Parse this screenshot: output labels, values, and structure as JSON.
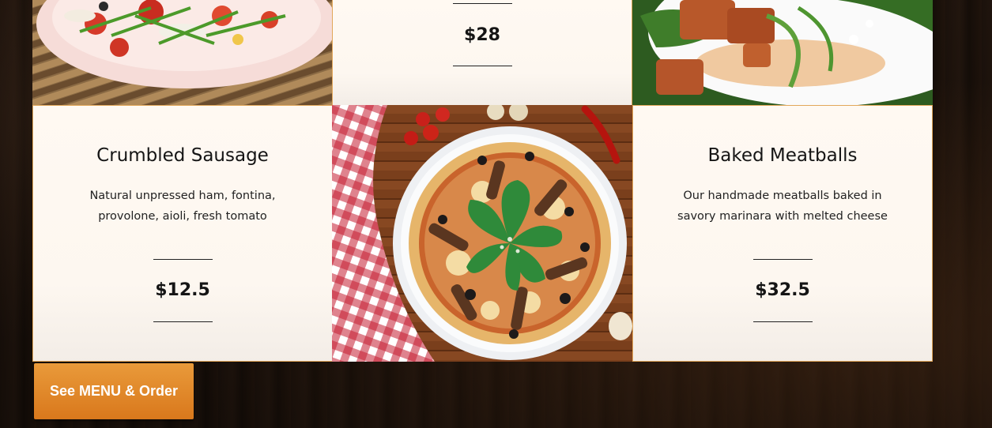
{
  "menu": {
    "top_middle": {
      "price": "$28"
    },
    "items": [
      {
        "title": "Crumbled Sausage",
        "description": "Natural unpressed ham, fontina, provolone, aioli, fresh tomato",
        "price": "$12.5"
      },
      {
        "title": "Baked Meatballs",
        "description": "Our handmade meatballs baked in savory marinara with melted cheese",
        "price": "$32.5"
      }
    ]
  },
  "cta": {
    "label": "See MENU & Order"
  },
  "colors": {
    "accent": "#d9781c",
    "card_border": "#e2a75a",
    "card_bg": "#fff9f2"
  }
}
